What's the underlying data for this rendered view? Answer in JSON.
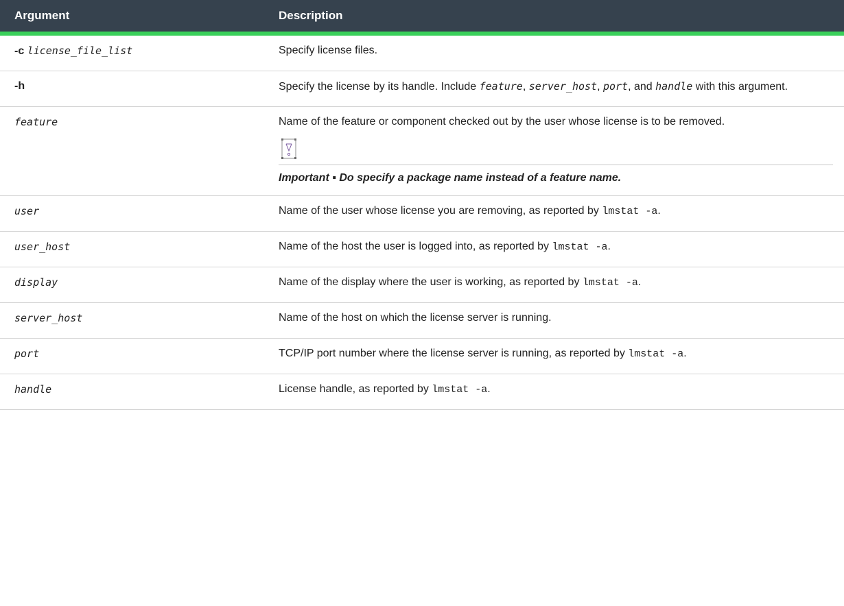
{
  "header": {
    "col_argument": "Argument",
    "col_description": "Description"
  },
  "rows": [
    {
      "option": "-c",
      "arg": "license_file_list",
      "desc": "Specify license files."
    },
    {
      "option": "-h",
      "desc_parts": [
        "Specify the license by its handle. Include ",
        "feature",
        ", ",
        "server_host",
        ", ",
        "port",
        ", and ",
        "handle",
        " with this argument."
      ]
    },
    {
      "arg": "feature",
      "desc": "Name of the feature or component checked out by the user whose license is to be removed.",
      "note": {
        "icon": "important-warning-icon",
        "label": "Important",
        "separator": " ▪ ",
        "text": "Do specify a package name instead of a feature name."
      }
    },
    {
      "arg": "user",
      "desc": "Name of the user whose license you are removing, as reported by ",
      "code": "lmstat -a",
      "tail": "."
    },
    {
      "arg": "user_host",
      "desc": "Name of the host the user is logged into, as reported by ",
      "code": "lmstat -a",
      "tail": "."
    },
    {
      "arg": "display",
      "desc": "Name of the display where the user is working, as reported by ",
      "code": "lmstat -a",
      "tail": "."
    },
    {
      "arg": "server_host",
      "desc": "Name of the host on which the license server is running."
    },
    {
      "arg": "port",
      "desc": "TCP/IP port number where the license server is running, as reported by ",
      "code": "lmstat -a",
      "tail": "."
    },
    {
      "arg": "handle",
      "desc": "License handle, as reported by ",
      "code": "lmstat -a",
      "tail": "."
    }
  ],
  "colors": {
    "header_bg": "#36424e",
    "header_rule": "#3ad05a",
    "row_rule": "#d4d4d4"
  }
}
